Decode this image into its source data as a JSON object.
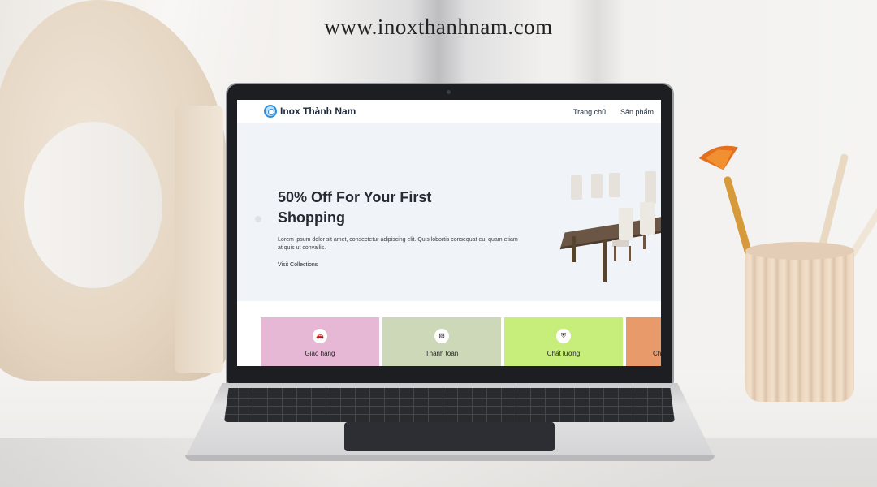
{
  "banner": {
    "url": "www.inoxthanhnam.com"
  },
  "website": {
    "brand": "Inox Thành Nam",
    "nav": [
      "Trang chủ",
      "Sản phẩm"
    ],
    "hero": {
      "title": "50% Off For Your First Shopping",
      "text": "Lorem ipsum dolor sit amet, consectetur adipiscing elit. Quis lobortis consequat eu, quam etiam at quis ut convallis.",
      "link": "Visit Collections"
    },
    "features": [
      {
        "label": "Giao hàng",
        "icon": "car-icon",
        "color": "#e6b8d6"
      },
      {
        "label": "Thanh toán",
        "icon": "credit-card-icon",
        "color": "#cdd8b8"
      },
      {
        "label": "Chất lượng",
        "icon": "shield-icon",
        "color": "#c7ed7a"
      },
      {
        "label": "Ch",
        "icon": "",
        "color": "#e99a6b"
      }
    ]
  }
}
